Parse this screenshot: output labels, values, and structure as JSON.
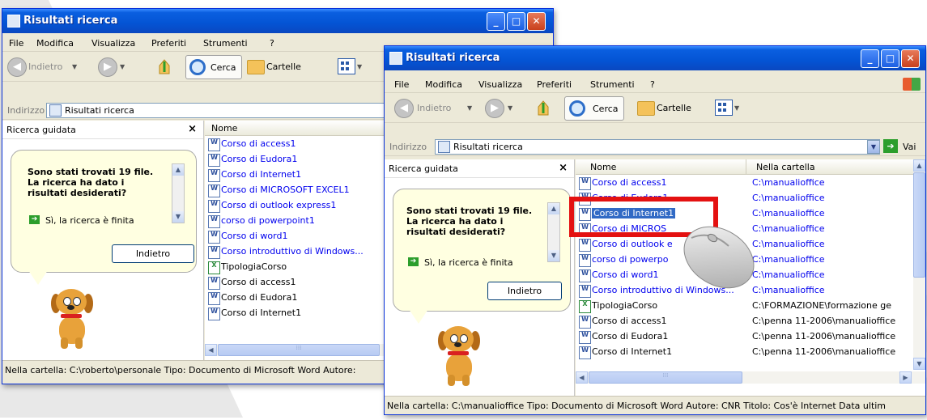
{
  "colors": {
    "titlebar": "#0454d4",
    "link": "#0000ee",
    "highlight": "#e41111",
    "bubble": "#ffffe1"
  },
  "back_window": {
    "title": "Risultati ricerca",
    "menu": [
      "File",
      "Modifica",
      "Visualizza",
      "Preferiti",
      "Strumenti",
      "?"
    ],
    "toolbar": {
      "back_label": "Indietro",
      "search_label": "Cerca",
      "folders_label": "Cartelle"
    },
    "address": {
      "label": "Indirizzo",
      "value": "Risultati ricerca"
    },
    "left_pane": {
      "title": "Ricerca guidata",
      "close": "×",
      "bubble_text": [
        "Sono stati trovati 19 file.",
        "La ricerca ha dato i",
        "risultati desiderati?"
      ],
      "option": "Sì, la ricerca è finita",
      "back_button": "Indietro"
    },
    "columns": {
      "name": "Nome"
    },
    "files": [
      {
        "name": "Corso di access1",
        "type": "doc",
        "link": true
      },
      {
        "name": "Corso di Eudora1",
        "type": "doc",
        "link": true
      },
      {
        "name": "Corso di Internet1",
        "type": "doc",
        "link": true
      },
      {
        "name": "Corso di MICROSOFT EXCEL1",
        "type": "doc",
        "link": true
      },
      {
        "name": "Corso di outlook express1",
        "type": "doc",
        "link": true
      },
      {
        "name": "corso di powerpoint1",
        "type": "doc",
        "link": true
      },
      {
        "name": "Corso di word1",
        "type": "doc",
        "link": true
      },
      {
        "name": "Corso introduttivo di Windows...",
        "type": "doc",
        "link": true
      },
      {
        "name": "TipologiaCorso",
        "type": "xls",
        "link": false
      },
      {
        "name": "Corso di access1",
        "type": "doc",
        "link": false
      },
      {
        "name": "Corso di Eudora1",
        "type": "doc",
        "link": false
      },
      {
        "name": "Corso di Internet1",
        "type": "doc",
        "link": false
      }
    ],
    "status": "Nella cartella: C:\\roberto\\personale Tipo: Documento di Microsoft Word Autore:"
  },
  "front_window": {
    "title": "Risultati ricerca",
    "menu": [
      "File",
      "Modifica",
      "Visualizza",
      "Preferiti",
      "Strumenti",
      "?"
    ],
    "toolbar": {
      "back_label": "Indietro",
      "search_label": "Cerca",
      "folders_label": "Cartelle"
    },
    "address": {
      "label": "Indirizzo",
      "value": "Risultati ricerca",
      "go_label": "Vai"
    },
    "left_pane": {
      "title": "Ricerca guidata",
      "close": "×",
      "bubble_text": [
        "Sono stati trovati 19 file.",
        "La ricerca ha dato i",
        "risultati desiderati?"
      ],
      "option": "Sì, la ricerca è finita",
      "back_button": "Indietro"
    },
    "columns": {
      "name": "Nome",
      "folder": "Nella cartella"
    },
    "files": [
      {
        "name": "Corso di access1",
        "folder": "C:\\manualioffice",
        "type": "doc",
        "link": true
      },
      {
        "name": "Corso di Eudora1",
        "folder": "C:\\manualioffice",
        "type": "doc",
        "link": true
      },
      {
        "name": "Corso di Internet1",
        "folder": "C:\\manualioffice",
        "type": "doc",
        "link": true
      },
      {
        "name": "Corso di MICROS",
        "folder": "C:\\manualioffice",
        "type": "doc",
        "link": true
      },
      {
        "name": "Corso di outlook e",
        "folder": "C:\\manualioffice",
        "type": "doc",
        "link": true
      },
      {
        "name": "corso di powerpo",
        "folder": "C:\\manualioffice",
        "type": "doc",
        "link": true
      },
      {
        "name": "Corso di word1",
        "folder": "C:\\manualioffice",
        "type": "doc",
        "link": true
      },
      {
        "name": "Corso introduttivo di Windows...",
        "folder": "C:\\manualioffice",
        "type": "doc",
        "link": true
      },
      {
        "name": "TipologiaCorso",
        "folder": "C:\\FORMAZIONE\\formazione ge",
        "type": "xls",
        "link": false
      },
      {
        "name": "Corso di access1",
        "folder": "C:\\penna 11-2006\\manualioffice",
        "type": "doc",
        "link": false
      },
      {
        "name": "Corso di Eudora1",
        "folder": "C:\\penna 11-2006\\manualioffice",
        "type": "doc",
        "link": false
      },
      {
        "name": "Corso di Internet1",
        "folder": "C:\\penna 11-2006\\manualioffice",
        "type": "doc",
        "link": false
      }
    ],
    "selected_file": "Corso di Internet1",
    "status": "Nella cartella: C:\\manualioffice Tipo: Documento di Microsoft Word Autore: CNR Titolo: Cos'è Internet Data ultim"
  }
}
